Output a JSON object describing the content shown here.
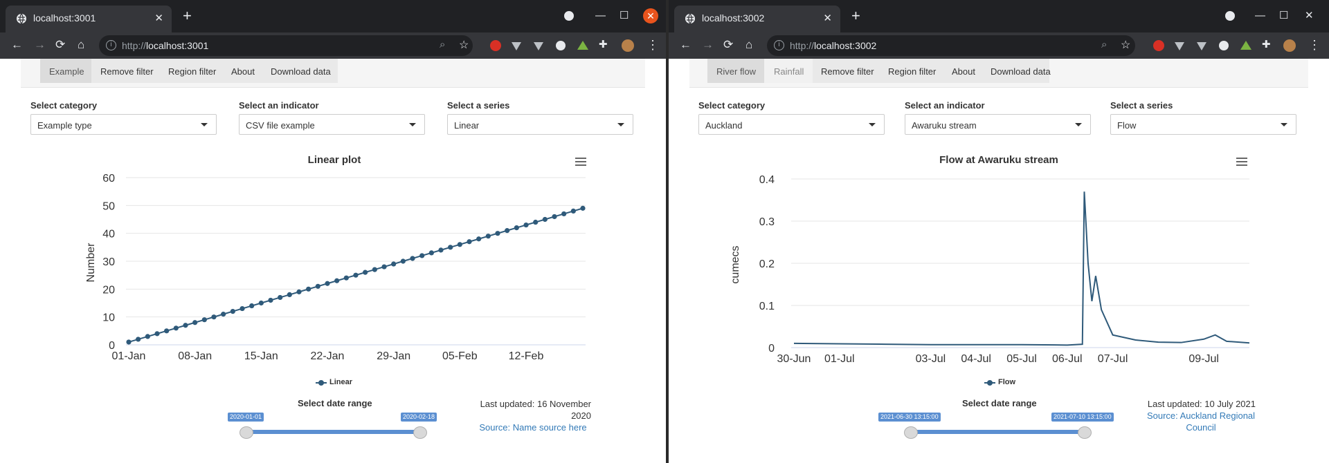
{
  "windows": [
    {
      "tab_title": "localhost:3001",
      "url": "http://localhost:3001",
      "url_prefix": "http://",
      "url_host": "localhost:3001",
      "nav": [
        "Example",
        "Remove filter",
        "Region filter",
        "About",
        "Download data"
      ],
      "filters": [
        {
          "label": "Select category",
          "value": "Example type"
        },
        {
          "label": "Select an indicator",
          "value": "CSV file example"
        },
        {
          "label": "Select a series",
          "value": "Linear"
        }
      ],
      "range_title": "Select date range",
      "range_start": "2020-01-01",
      "range_end": "2020-02-18",
      "updated": "Last updated: 16 November 2020",
      "source": "Source: Name source here"
    },
    {
      "tab_title": "localhost:3002",
      "url": "http://localhost:3002",
      "url_prefix": "http://",
      "url_host": "localhost:3002",
      "nav": [
        "River flow",
        "Rainfall",
        "Remove filter",
        "Region filter",
        "About",
        "Download data"
      ],
      "filters": [
        {
          "label": "Select category",
          "value": "Auckland"
        },
        {
          "label": "Select an indicator",
          "value": "Awaruku stream"
        },
        {
          "label": "Select a series",
          "value": "Flow"
        }
      ],
      "range_title": "Select date range",
      "range_start": "2021-06-30 13:15:00",
      "range_end": "2021-07-10 13:15:00",
      "updated": "Last updated: 10 July 2021",
      "source": "Source: Auckland Regional Council"
    }
  ],
  "colors": {
    "series": "#2f5a7a",
    "accent": "#5b8fd1",
    "link": "#337ab7",
    "close": "#e9541d"
  },
  "chart_data": [
    {
      "type": "line",
      "title": "Linear plot",
      "ylabel": "Number",
      "xlabel": "",
      "legend": "bottom",
      "series": [
        {
          "name": "Linear",
          "start": "2020-01-01",
          "end": "2020-02-18",
          "values": [
            1,
            2,
            3,
            4,
            5,
            6,
            7,
            8,
            9,
            10,
            11,
            12,
            13,
            14,
            15,
            16,
            17,
            18,
            19,
            20,
            21,
            22,
            23,
            24,
            25,
            26,
            27,
            28,
            29,
            30,
            31,
            32,
            33,
            34,
            35,
            36,
            37,
            38,
            39,
            40,
            41,
            42,
            43,
            44,
            45,
            46,
            47,
            48,
            49
          ]
        }
      ],
      "x_ticks": [
        "01-Jan",
        "08-Jan",
        "15-Jan",
        "22-Jan",
        "29-Jan",
        "05-Feb",
        "12-Feb"
      ],
      "y_ticks": [
        0,
        10,
        20,
        30,
        40,
        50,
        60
      ],
      "ylim": [
        0,
        60
      ],
      "grid": true
    },
    {
      "type": "line",
      "title": "Flow at Awaruku stream",
      "ylabel": "cumecs",
      "xlabel": "",
      "legend": "bottom",
      "series": [
        {
          "name": "Flow",
          "points": [
            [
              "2021-06-30",
              0.01
            ],
            [
              "2021-07-01",
              0.009
            ],
            [
              "2021-07-02",
              0.008
            ],
            [
              "2021-07-03",
              0.007
            ],
            [
              "2021-07-04",
              0.007
            ],
            [
              "2021-07-05",
              0.007
            ],
            [
              "2021-07-06",
              0.006
            ],
            [
              "2021-07-06 08:00",
              0.008
            ],
            [
              "2021-07-06 09:00",
              0.37
            ],
            [
              "2021-07-06 11:00",
              0.2
            ],
            [
              "2021-07-06 13:00",
              0.11
            ],
            [
              "2021-07-06 15:00",
              0.17
            ],
            [
              "2021-07-06 18:00",
              0.09
            ],
            [
              "2021-07-07",
              0.03
            ],
            [
              "2021-07-07 12:00",
              0.018
            ],
            [
              "2021-07-08",
              0.013
            ],
            [
              "2021-07-08 12:00",
              0.012
            ],
            [
              "2021-07-09",
              0.02
            ],
            [
              "2021-07-09 06:00",
              0.03
            ],
            [
              "2021-07-09 12:00",
              0.015
            ],
            [
              "2021-07-10",
              0.011
            ]
          ]
        }
      ],
      "x_ticks": [
        "30-Jun",
        "01-Jul",
        "03-Jul",
        "04-Jul",
        "05-Jul",
        "06-Jul",
        "07-Jul",
        "09-Jul"
      ],
      "y_ticks": [
        0,
        0.1,
        0.2,
        0.3,
        0.4
      ],
      "ylim": [
        0,
        0.4
      ],
      "grid": true
    }
  ]
}
